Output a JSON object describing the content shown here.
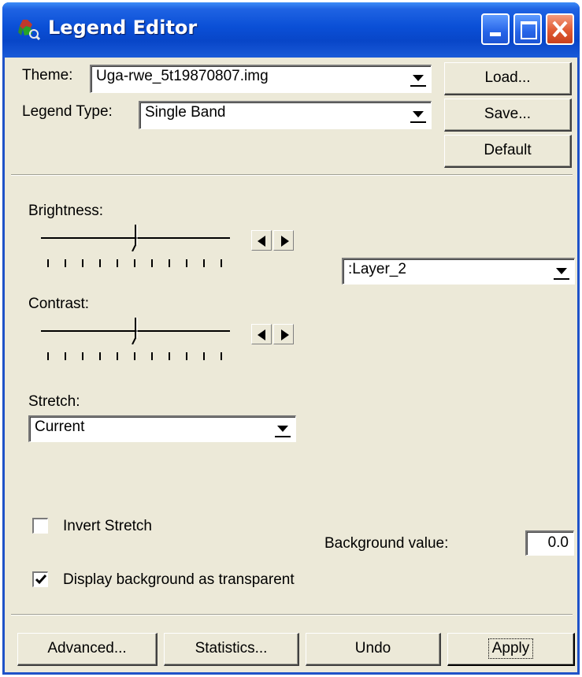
{
  "window": {
    "title": "Legend Editor"
  },
  "top": {
    "theme_label": "Theme:",
    "theme_value": "Uga-rwe_5t19870807.img",
    "legend_type_label": "Legend Type:",
    "legend_type_value": "Single Band",
    "load_button": "Load...",
    "save_button": "Save...",
    "default_button": "Default"
  },
  "controls": {
    "brightness_label": "Brightness:",
    "brightness_level": 0.5,
    "contrast_label": "Contrast:",
    "contrast_level": 0.5,
    "layer_value": ":Layer_2",
    "stretch_label": "Stretch:",
    "stretch_value": "Current",
    "invert_stretch_label": "Invert Stretch",
    "invert_stretch_checked": false,
    "background_value_label": "Background value:",
    "background_value": "0.0",
    "display_transparent_label": "Display background as transparent",
    "display_transparent_checked": true
  },
  "bottom": {
    "advanced_button": "Advanced...",
    "statistics_button": "Statistics...",
    "undo_button": "Undo",
    "apply_button": "Apply"
  },
  "colors": {
    "titlebar": "#0a4fd6",
    "dialog_bg": "#ece9d8",
    "close_button": "#e05a32"
  }
}
